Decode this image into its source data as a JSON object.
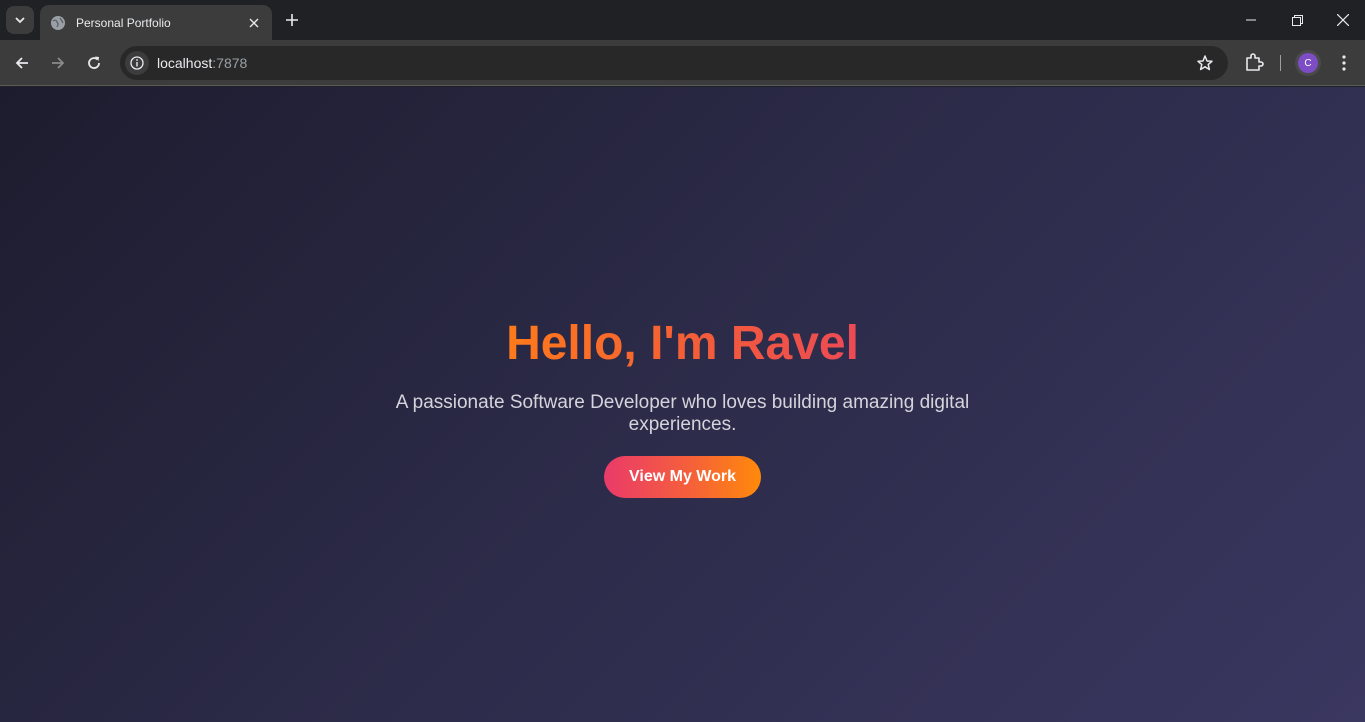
{
  "browser": {
    "tab_title": "Personal Portfolio",
    "url_host": "localhost",
    "url_port": ":7878",
    "profile_initial": "C"
  },
  "hero": {
    "heading": "Hello, I'm Ravel",
    "subtitle": "A passionate Software Developer who loves building amazing digital experiences.",
    "cta_label": "View My Work"
  },
  "colors": {
    "heading_gradient": [
      "#ff7a1a",
      "#ec4a55"
    ],
    "button_gradient": [
      "#ea3a6a",
      "#ff8a0a"
    ],
    "background": "#2b2a47"
  }
}
